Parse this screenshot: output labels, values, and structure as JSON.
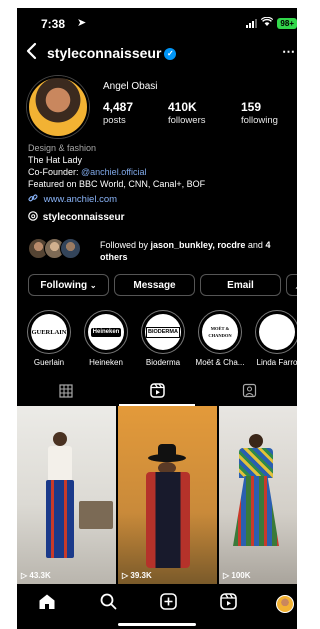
{
  "status": {
    "time": "7:38",
    "battery": "98+"
  },
  "header": {
    "username": "styleconnaisseur"
  },
  "profile": {
    "full_name": "Angel Obasi",
    "stats": [
      {
        "value": "4,487",
        "label": "posts"
      },
      {
        "value": "410K",
        "label": "followers"
      },
      {
        "value": "159",
        "label": "following"
      }
    ],
    "bio": {
      "category": "Design & fashion",
      "line1": "The Hat Lady",
      "cofounder_prefix": "Co-Founder: ",
      "cofounder_mention": "@anchiel.official",
      "line3": "Featured on BBC World, CNN, Canal+, BOF"
    },
    "link": "www.anchiel.com",
    "threads_handle": "styleconnaisseur",
    "followed_by": {
      "prefix": "Followed by ",
      "names": "jason_bunkley, rocdre",
      "and": " and ",
      "others": "4 others"
    }
  },
  "buttons": {
    "following": "Following",
    "message": "Message",
    "email": "Email"
  },
  "highlights": [
    {
      "label": "Guerlain",
      "logo": "GUERLAIN"
    },
    {
      "label": "Heineken",
      "logo": "Heineken"
    },
    {
      "label": "Bioderma",
      "logo": "BIODERMA"
    },
    {
      "label": "Moët & Cha...",
      "logo": "MOËT & CHANDON"
    },
    {
      "label": "Linda Farro",
      "logo": ""
    }
  ],
  "posts": [
    {
      "views": "43.3K"
    },
    {
      "views": "39.3K"
    },
    {
      "views": "100K"
    }
  ],
  "colors": {
    "accent_link": "#8ab4f8",
    "verified": "#0095f6",
    "battery": "#32d74b"
  }
}
